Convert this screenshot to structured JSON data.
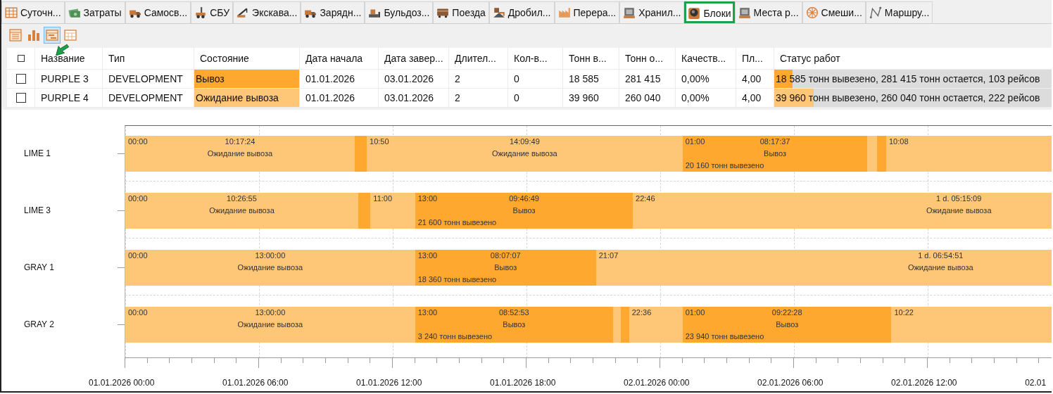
{
  "tabs": [
    {
      "label": "Суточн...",
      "kind": "grid",
      "selected": false,
      "outlined": false
    },
    {
      "label": "Затраты",
      "kind": "money",
      "selected": false,
      "outlined": false
    },
    {
      "label": "Самосв...",
      "kind": "truck",
      "selected": false,
      "outlined": false
    },
    {
      "label": "СБУ",
      "kind": "drill",
      "selected": false,
      "outlined": false
    },
    {
      "label": "Экскава...",
      "kind": "crane",
      "selected": false,
      "outlined": false
    },
    {
      "label": "Зарядн...",
      "kind": "truck",
      "selected": false,
      "outlined": false
    },
    {
      "label": "Бульдоз...",
      "kind": "dozer",
      "selected": false,
      "outlined": false
    },
    {
      "label": "Поезда",
      "kind": "train",
      "selected": false,
      "outlined": false
    },
    {
      "label": "Дробил...",
      "kind": "crusher",
      "selected": false,
      "outlined": false
    },
    {
      "label": "Перера...",
      "kind": "factory",
      "selected": false,
      "outlined": false
    },
    {
      "label": "Хранил...",
      "kind": "storage",
      "selected": false,
      "outlined": false
    },
    {
      "label": "Блоки",
      "kind": "block",
      "selected": true,
      "outlined": true
    },
    {
      "label": "Места р...",
      "kind": "storage",
      "selected": false,
      "outlined": false
    },
    {
      "label": "Смеши...",
      "kind": "mixer",
      "selected": false,
      "outlined": false
    },
    {
      "label": "Маршру...",
      "kind": "route",
      "selected": false,
      "outlined": false
    }
  ],
  "toolbar": [
    {
      "kind": "table",
      "selected": false,
      "pointed": false
    },
    {
      "kind": "bars",
      "selected": false,
      "pointed": false
    },
    {
      "kind": "gantt",
      "selected": true,
      "pointed": true
    },
    {
      "kind": "calendar",
      "selected": false,
      "pointed": false
    }
  ],
  "table": {
    "all_checked": false,
    "columns": [
      "Название",
      "Тип",
      "Состояние",
      "Дата начала",
      "Дата завер...",
      "Длител...",
      "Кол-в...",
      "Тонн в...",
      "Тонн о...",
      "Качеств...",
      "Пл...",
      "Статус работ"
    ],
    "rows": [
      {
        "checked": false,
        "kind": "haul",
        "cells": [
          "PURPLE 3",
          "DEVELOPMENT",
          "Вывоз",
          "01.01.2026",
          "03.01.2026",
          "2",
          "0",
          "18 585",
          "281 415",
          "0,00%",
          "4,00"
        ],
        "level": 0.062,
        "status": "18 585 тонн вывезено, 281 415 тонн остается, 103 рейсов"
      },
      {
        "checked": false,
        "kind": "wait",
        "cells": [
          "PURPLE 4",
          "DEVELOPMENT",
          "Ожидание вывоза",
          "01.01.2026",
          "03.01.2026",
          "2",
          "0",
          "39 960",
          "260 040",
          "0,00%",
          "4,00"
        ],
        "level": 0.133,
        "status": "39 960 тонн вывезено, 260 040 тонн остается, 222 рейсов"
      }
    ]
  },
  "gantt": {
    "ticks": [
      "01.01.2026 00:00",
      "01.01.2026 06:00",
      "01.01.2026 12:00",
      "01.01.2026 18:00",
      "02.01.2026 00:00",
      "02.01.2026 06:00",
      "02.01.2026 12:00",
      "02.01"
    ],
    "rows": [
      {
        "name": "LIME 1",
        "segments": [
          {
            "kind": "wait",
            "start_label": "00:00",
            "duration": "10:17:24",
            "state_label": "Ожидание вывоза"
          },
          {
            "kind": "haul"
          },
          {
            "kind": "wait",
            "start_label": "10:50",
            "duration": "14:09:49",
            "state_label": "Ожидание вывоза"
          },
          {
            "kind": "haul",
            "start_label": "01:00",
            "duration": "08:17:37",
            "state_label": "Вывоз",
            "tons": "20 160 тонн вывезено"
          },
          {
            "kind": "wait"
          },
          {
            "kind": "haul"
          },
          {
            "kind": "wait",
            "start_label": "10:08"
          }
        ]
      },
      {
        "name": "LIME 3",
        "segments": [
          {
            "kind": "wait",
            "start_label": "00:00",
            "duration": "10:26:55",
            "state_label": "Ожидание вывоза"
          },
          {
            "kind": "haul"
          },
          {
            "kind": "wait",
            "start_label": "11:00"
          },
          {
            "kind": "haul",
            "start_label": "13:00",
            "duration": "09:46:49",
            "state_label": "Вывоз",
            "tons": "21 600 тонн вывезено"
          },
          {
            "kind": "wait",
            "start_label": "22:46",
            "duration": "1 d. 05:15:09",
            "state_label": "Ожидание вывоза"
          }
        ]
      },
      {
        "name": "GRAY 1",
        "segments": [
          {
            "kind": "wait",
            "start_label": "00:00",
            "duration": "13:00:00",
            "state_label": "Ожидание вывоза"
          },
          {
            "kind": "haul",
            "start_label": "13:00",
            "duration": "08:07:07",
            "state_label": "Вывоз",
            "tons": "18 360 тонн вывезено"
          },
          {
            "kind": "wait",
            "start_label": "21:07",
            "duration": "1 d. 06:54:51",
            "state_label": "Ожидание вывоза"
          }
        ]
      },
      {
        "name": "GRAY 2",
        "segments": [
          {
            "kind": "wait",
            "start_label": "00:00",
            "duration": "13:00:00",
            "state_label": "Ожидание вывоза"
          },
          {
            "kind": "haul",
            "start_label": "13:00",
            "duration": "08:52:53",
            "state_label": "Вывоз",
            "tons": "3 240 тонн вывезено"
          },
          {
            "kind": "wait"
          },
          {
            "kind": "haul"
          },
          {
            "kind": "wait",
            "start_label": "22:36"
          },
          {
            "kind": "haul",
            "start_label": "01:00",
            "duration": "09:22:28",
            "state_label": "Вывоз",
            "tons": "23 940 тонн вывезено"
          },
          {
            "kind": "wait",
            "start_label": "10:22"
          }
        ]
      }
    ]
  }
}
